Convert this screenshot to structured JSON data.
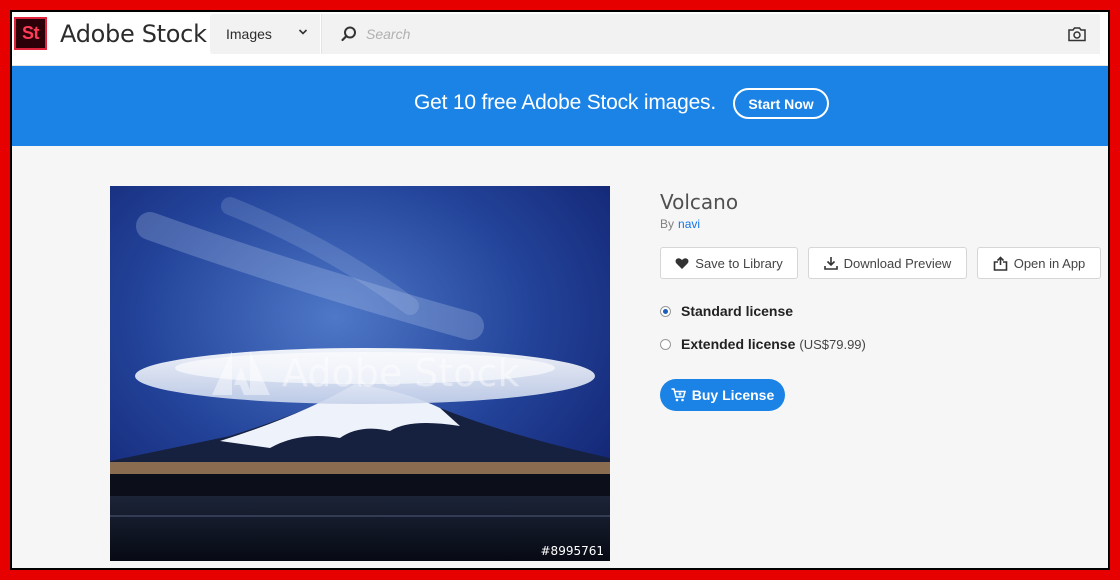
{
  "header": {
    "logo_badge": "St",
    "brand": "Adobe Stock",
    "type_selected": "Images",
    "search_placeholder": "Search"
  },
  "banner": {
    "text": "Get 10 free Adobe Stock images.",
    "cta": "Start Now"
  },
  "asset": {
    "title": "Volcano",
    "by_prefix": "By",
    "author": "navi",
    "watermark": "Adobe Stock",
    "id": "#8995761"
  },
  "actions": {
    "save": "Save to Library",
    "download": "Download Preview",
    "open": "Open in App"
  },
  "licenses": [
    {
      "label": "Standard license",
      "price": "",
      "selected": true
    },
    {
      "label": "Extended license",
      "price": "(US$79.99)",
      "selected": false
    }
  ],
  "buy": "Buy License",
  "colors": {
    "frame": "#e60000",
    "accent": "#1b83e6",
    "link": "#1473e6",
    "logo_bg": "#2b0008",
    "logo_fg": "#ff3c55"
  },
  "icons": [
    "chevron-down-icon",
    "search-icon",
    "camera-icon",
    "heart-icon",
    "download-icon",
    "share-icon",
    "cart-icon",
    "adobe-logo-icon"
  ]
}
